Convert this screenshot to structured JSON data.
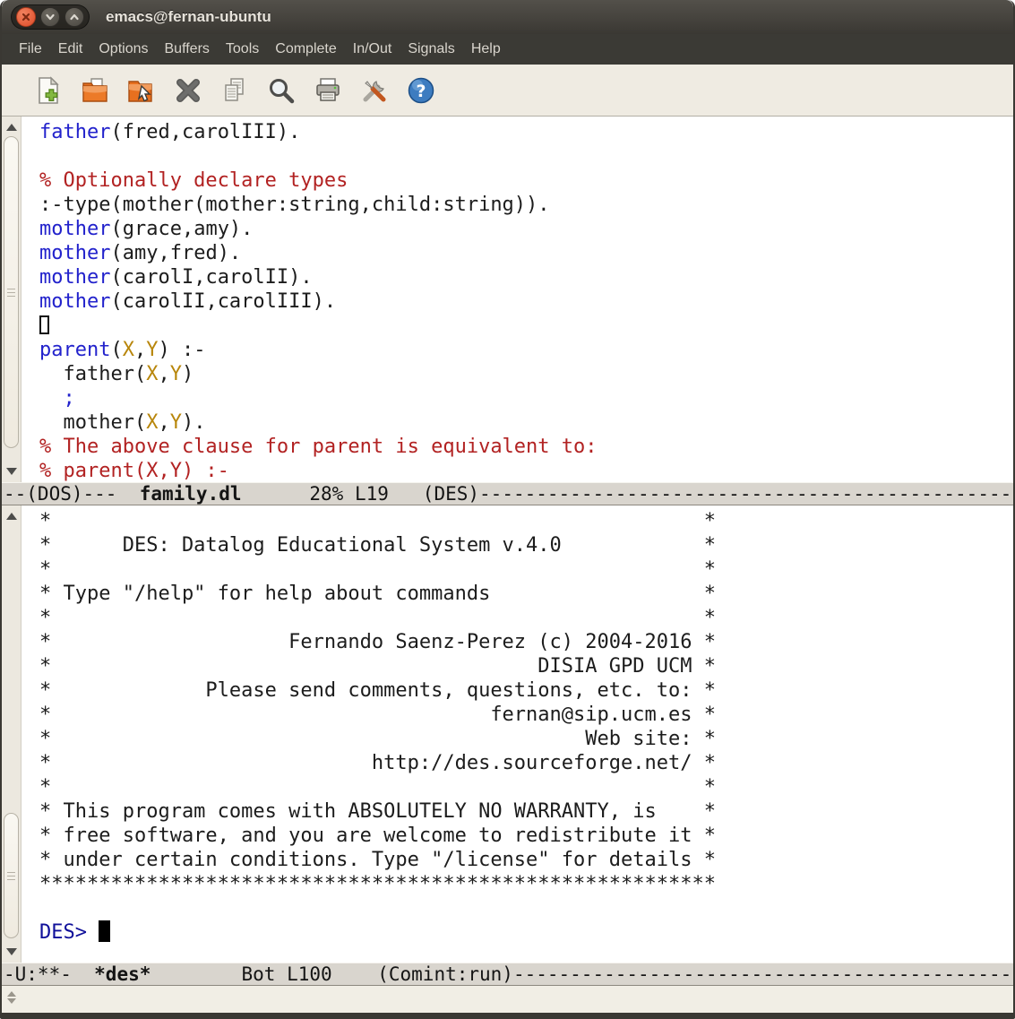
{
  "window": {
    "title": "emacs@fernan-ubuntu",
    "buttons": [
      "close",
      "minimize",
      "maximize"
    ]
  },
  "menu": {
    "items": [
      "File",
      "Edit",
      "Options",
      "Buffers",
      "Tools",
      "Complete",
      "In/Out",
      "Signals",
      "Help"
    ]
  },
  "toolbar": {
    "buttons": [
      "new-file",
      "open-file",
      "open-directory",
      "close-buffer",
      "copy",
      "search",
      "print",
      "preferences",
      "help"
    ]
  },
  "colors": {
    "fn": "#2222cc",
    "var": "#b8860b",
    "cmt": "#b22222",
    "def": "#1c1c1c",
    "prm": "#10109a"
  },
  "editor": {
    "buffer_name": "family.dl",
    "lines": [
      [
        {
          "t": "father",
          "c": "fn"
        },
        {
          "t": "(fred,carolIII)."
        }
      ],
      [],
      [
        {
          "t": "% Optionally declare types",
          "c": "cmt"
        }
      ],
      [
        {
          "t": ":-type(mother(mother:string,child:string))."
        }
      ],
      [
        {
          "t": "mother",
          "c": "fn"
        },
        {
          "t": "(grace,amy)."
        }
      ],
      [
        {
          "t": "mother",
          "c": "fn"
        },
        {
          "t": "(amy,fred)."
        }
      ],
      [
        {
          "t": "mother",
          "c": "fn"
        },
        {
          "t": "(carolI,carolII)."
        }
      ],
      [
        {
          "t": "mother",
          "c": "fn"
        },
        {
          "t": "(carolII,carolIII)."
        }
      ],
      [
        {
          "cursor": "hollow"
        }
      ],
      [
        {
          "t": "parent",
          "c": "fn"
        },
        {
          "t": "("
        },
        {
          "t": "X",
          "c": "var"
        },
        {
          "t": ","
        },
        {
          "t": "Y",
          "c": "var"
        },
        {
          "t": ") :-"
        }
      ],
      [
        {
          "t": "  father("
        },
        {
          "t": "X",
          "c": "var"
        },
        {
          "t": ","
        },
        {
          "t": "Y",
          "c": "var"
        },
        {
          "t": ")"
        }
      ],
      [
        {
          "t": "  "
        },
        {
          "t": ";",
          "c": "fn"
        }
      ],
      [
        {
          "t": "  mother("
        },
        {
          "t": "X",
          "c": "var"
        },
        {
          "t": ","
        },
        {
          "t": "Y",
          "c": "var"
        },
        {
          "t": ")."
        }
      ],
      [
        {
          "t": "% The above clause for parent is equivalent to:",
          "c": "cmt"
        }
      ],
      [
        {
          "t": "% parent(X,Y) :-",
          "c": "cmt"
        }
      ]
    ]
  },
  "modeline_top": {
    "segments": [
      {
        "t": "--(DOS)---  "
      },
      {
        "t": "family.dl",
        "b": true
      },
      {
        "t": "      28% L19   (DES)"
      }
    ],
    "dashes": "------------------------------------------------------------"
  },
  "repl": {
    "buffer_name": "*des*",
    "banner_lines": [
      "*                                                       *",
      "*      DES: Datalog Educational System v.4.0            *",
      "*                                                       *",
      "* Type \"/help\" for help about commands                  *",
      "*                                                       *",
      "*                    Fernando Saenz-Perez (c) 2004-2016 *",
      "*                                         DISIA GPD UCM *",
      "*             Please send comments, questions, etc. to: *",
      "*                                     fernan@sip.ucm.es *",
      "*                                             Web site: *",
      "*                           http://des.sourceforge.net/ *",
      "*                                                       *",
      "* This program comes with ABSOLUTELY NO WARRANTY, is    *",
      "* free software, and you are welcome to redistribute it *",
      "* under certain conditions. Type \"/license\" for details *",
      "*********************************************************",
      ""
    ],
    "prompt": "DES> "
  },
  "modeline_bottom": {
    "segments": [
      {
        "t": "-U:**-  "
      },
      {
        "t": "*des*",
        "b": true
      },
      {
        "t": "        Bot L100    (Comint:run)"
      }
    ],
    "dashes": "------------------------------------------------------------"
  }
}
